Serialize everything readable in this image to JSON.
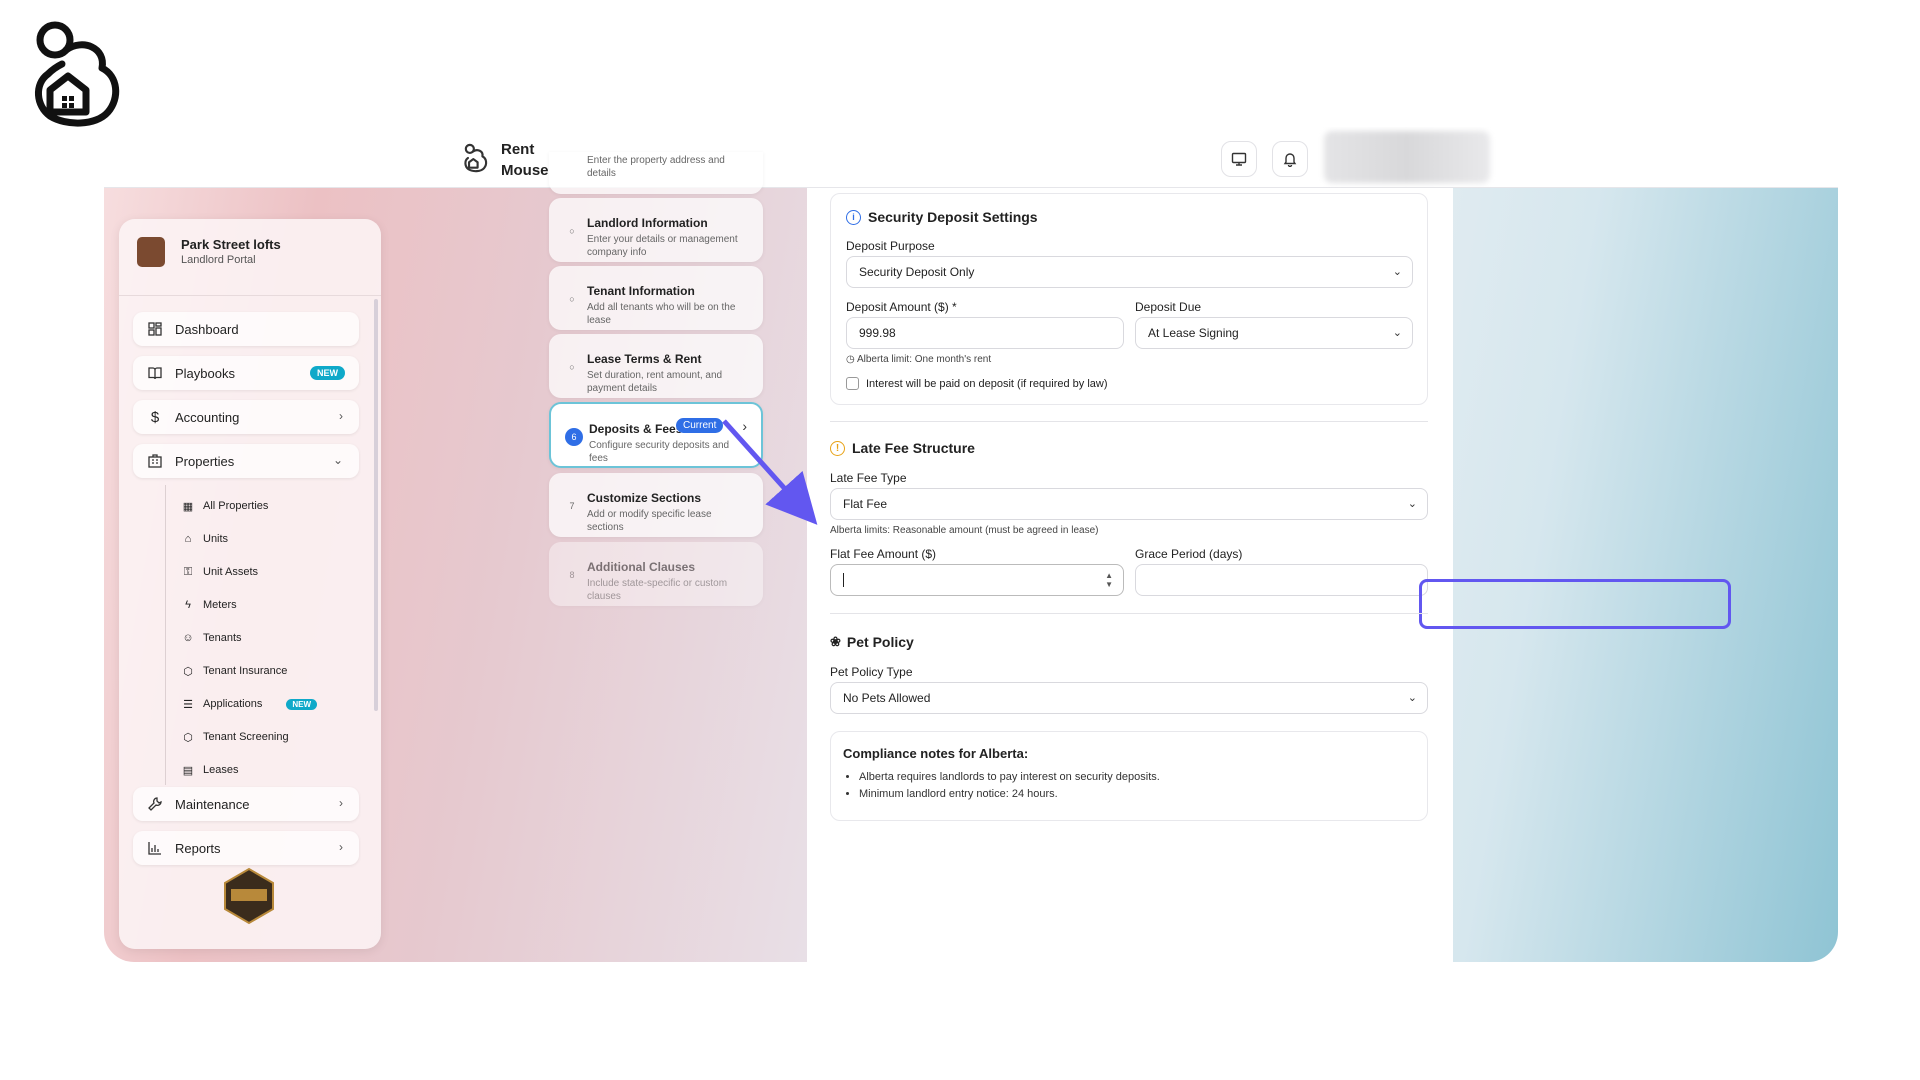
{
  "brand": {
    "line1": "Rent",
    "line2": "Mouse"
  },
  "sidebar": {
    "org_name": "Park Street lofts",
    "org_subtitle": "Landlord Portal",
    "nav": [
      {
        "label": "Dashboard",
        "icon": "dashboard-icon"
      },
      {
        "label": "Playbooks",
        "icon": "book-icon",
        "badge": "NEW"
      },
      {
        "label": "Accounting",
        "icon": "dollar-icon"
      },
      {
        "label": "Properties",
        "icon": "building-icon"
      }
    ],
    "properties_sub": [
      {
        "label": "All Properties",
        "icon": "building-icon"
      },
      {
        "label": "Units",
        "icon": "home-icon"
      },
      {
        "label": "Unit Assets",
        "icon": "key-icon"
      },
      {
        "label": "Meters",
        "icon": "bolt-icon"
      },
      {
        "label": "Tenants",
        "icon": "users-icon"
      },
      {
        "label": "Tenant Insurance",
        "icon": "shield-icon"
      },
      {
        "label": "Applications",
        "icon": "document-icon",
        "badge": "NEW"
      },
      {
        "label": "Tenant Screening",
        "icon": "shield-icon"
      },
      {
        "label": "Leases",
        "icon": "calendar-icon"
      }
    ],
    "nav_bottom": [
      {
        "label": "Maintenance",
        "icon": "wrench-icon"
      },
      {
        "label": "Reports",
        "icon": "bar-chart-icon"
      }
    ]
  },
  "steps": [
    {
      "num": "",
      "title": "",
      "desc": "Enter the property address and details"
    },
    {
      "num": "",
      "title": "Landlord Information",
      "desc": "Enter your details or management company info"
    },
    {
      "num": "",
      "title": "Tenant Information",
      "desc": "Add all tenants who will be on the lease"
    },
    {
      "num": "",
      "title": "Lease Terms & Rent",
      "desc": "Set duration, rent amount, and payment details"
    },
    {
      "num": "6",
      "title": "Deposits & Fees",
      "desc": "Configure security deposits and fees",
      "badge": "Current"
    },
    {
      "num": "7",
      "title": "Customize Sections",
      "desc": "Add or modify specific lease sections"
    },
    {
      "num": "8",
      "title": "Additional Clauses",
      "desc": "Include state-specific or custom clauses"
    }
  ],
  "security_deposit": {
    "title": "Security Deposit Settings",
    "purpose_label": "Deposit Purpose",
    "purpose_value": "Security Deposit Only",
    "amount_label": "Deposit Amount ($) *",
    "amount_value": "999.98",
    "due_label": "Deposit Due",
    "due_value": "At Lease Signing",
    "limit_note": "Alberta limit: One month's rent",
    "interest_label": "Interest will be paid on deposit (if required by law)"
  },
  "late_fee": {
    "title": "Late Fee Structure",
    "type_label": "Late Fee Type",
    "type_value": "Flat Fee",
    "limits_note": "Alberta limits: Reasonable amount (must be agreed in lease)",
    "amount_label": "Flat Fee Amount ($)",
    "amount_value": "",
    "grace_label": "Grace Period (days)",
    "grace_value": ""
  },
  "pet_policy": {
    "title": "Pet Policy",
    "type_label": "Pet Policy Type",
    "type_value": "No Pets Allowed"
  },
  "compliance": {
    "title": "Compliance notes for Alberta:",
    "items": [
      "Alberta requires landlords to pay interest on security deposits.",
      "Minimum landlord entry notice: 24 hours."
    ]
  },
  "colors": {
    "accent": "#2f6ee6",
    "highlight": "#6257f0",
    "badge_new": "#0fa9c9",
    "warning": "#e8a317"
  }
}
